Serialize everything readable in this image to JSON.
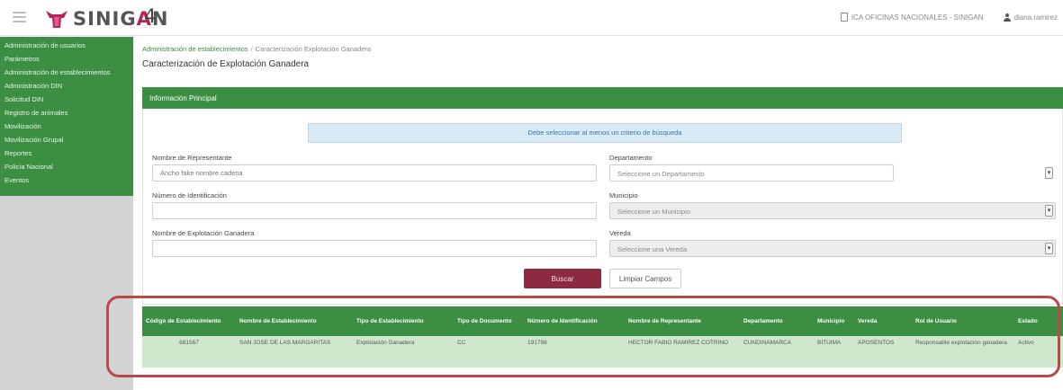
{
  "header": {
    "brand_prefix": "SINIG",
    "brand_accent": "A",
    "brand_suffix": "N",
    "version": "4",
    "office": "ICA OFICINAS NACIONALES - SINIGAN",
    "user": "diana.ramirez"
  },
  "sidebar": {
    "items": [
      {
        "label": "Administración de usuarios"
      },
      {
        "label": "Parámetros"
      },
      {
        "label": "Administración de establecimientos"
      },
      {
        "label": "Administración DIN"
      },
      {
        "label": "Solicitud DIN"
      },
      {
        "label": "Registro de animales"
      },
      {
        "label": "Movilización"
      },
      {
        "label": "Movilización Grupal"
      },
      {
        "label": "Reportes"
      },
      {
        "label": "Policía Nacional"
      },
      {
        "label": "Eventos"
      }
    ]
  },
  "breadcrumb": {
    "parent": "Administración de establecimientos",
    "separator": "/",
    "current": "Caracterización Explotación Ganadera"
  },
  "page": {
    "title": "Caracterización de Explotación Ganadera"
  },
  "panel": {
    "title": "Información Principal",
    "alert": "Debe seleccionar al menos un criterio de búsqueda"
  },
  "form": {
    "representante_label": "Nombre de Representante",
    "representante_placeholder": "Ancho fake nombre cadena",
    "identificacion_label": "Número de Identificación",
    "identificacion_value": "",
    "explotacion_label": "Nombre de Explotación Ganadera",
    "explotacion_value": "",
    "departamento_label": "Departamento",
    "departamento_value": "Seleccione un Departamento",
    "municipio_label": "Municipio",
    "municipio_value": "Seleccione un Municipio",
    "vereda_label": "Vereda",
    "vereda_value": "Seleccione una Vereda",
    "arrow_glyph": "▾",
    "buscar_label": "Buscar",
    "limpiar_label": "Limpiar Campos"
  },
  "results": {
    "columns": [
      "Código de Establecimiento",
      "Nombre de Establecimiento",
      "Tipo de Establecimiento",
      "Tipo de Documento",
      "Número de Identificación",
      "Nombre de Representante",
      "Departamento",
      "Municipio",
      "Vereda",
      "Rol de Usuario",
      "Estado"
    ],
    "rows": [
      [
        "681567",
        "SAN JOSE DE LAS MARGARITAS",
        "Explotación Ganadera",
        "CC",
        "191798",
        "HECTOR FABIO RAMIREZ COTRINO",
        "CUNDINAMARCA",
        "BITUIMA",
        "APOSENTOS",
        "Responsable explotación ganadera",
        "Activo"
      ]
    ]
  },
  "colors": {
    "brand_green": "#3b8e42",
    "buscar_button": "#8d2a3f",
    "row_fill": "#cfe8cd",
    "highlight_outline": "#b94a4a"
  }
}
